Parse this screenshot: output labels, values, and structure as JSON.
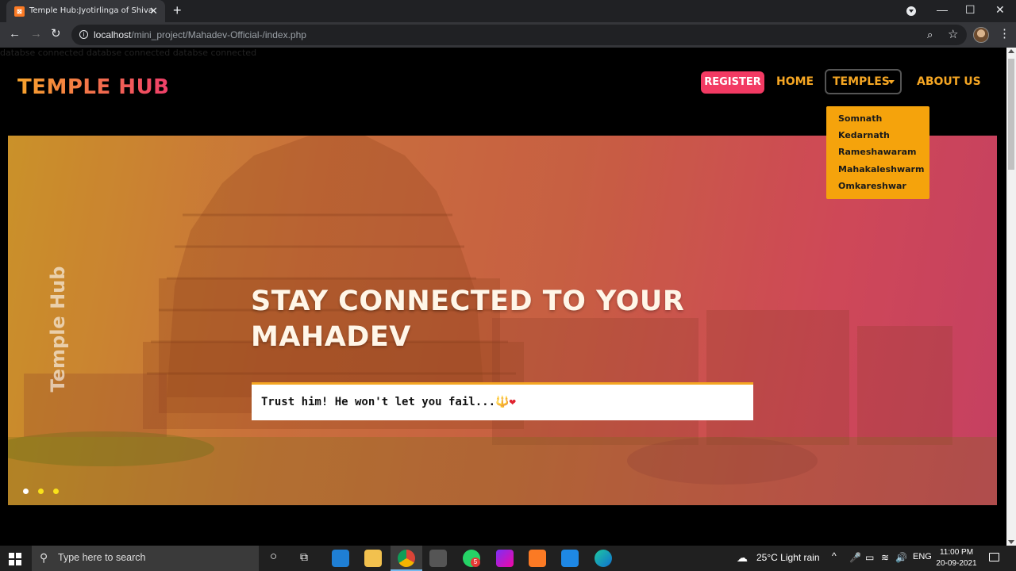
{
  "browser": {
    "tab_title": "Temple Hub:Jyotirlinga of Shiva",
    "url_host": "localhost",
    "url_path": "/mini_project/Mahadev-Official-/index.php"
  },
  "page": {
    "db_message": "databse connected databse connected databse connected",
    "logo": "TEMPLE HUB",
    "nav": {
      "register": "REGISTER",
      "home": "HOME",
      "temples": "TEMPLES",
      "about": "ABOUT US"
    },
    "dropdown": [
      "Somnath",
      "Kedarnath",
      "Rameshawaram",
      "Mahakaleshwarm",
      "Omkareshwar"
    ],
    "hero": {
      "vertical_brand": "Temple Hub",
      "title_line1": "STAY CONNECTED TO YOUR",
      "title_line2": "MAHADEV",
      "quote": "Trust him! He won't let you fail...",
      "quote_emoji_1": "🔱",
      "quote_emoji_2": "❤"
    },
    "carousel_dots": 3,
    "colors": {
      "accent_orange": "#f5a623",
      "register_pink": "#f23a63",
      "dropdown_bg": "#f5a30c"
    }
  },
  "taskbar": {
    "search_placeholder": "Type here to search",
    "weather": "25°C  Light rain",
    "language": "ENG",
    "time": "11:00 PM",
    "date": "20-09-2021",
    "whatsapp_badge": "5"
  }
}
